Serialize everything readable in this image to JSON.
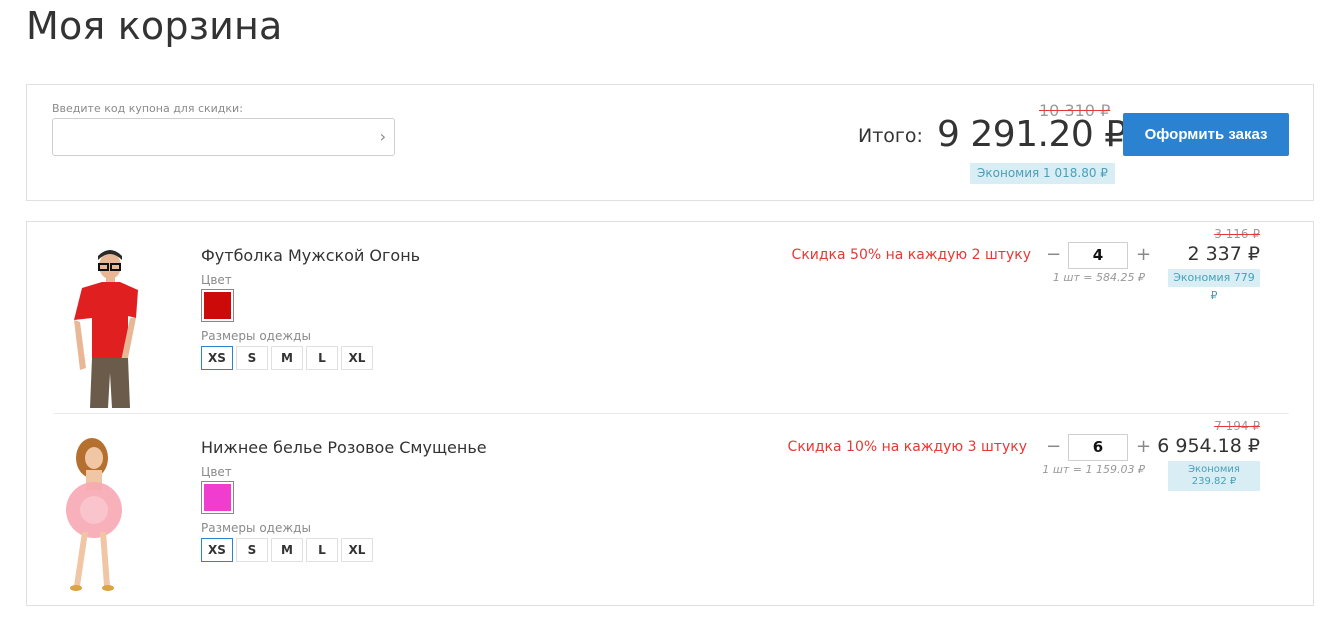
{
  "page": {
    "title": "Моя корзина"
  },
  "coupon": {
    "label": "Введите код купона для скидки:",
    "placeholder": "",
    "submit_icon": "chevron-right-icon"
  },
  "summary": {
    "total_label": "Итого:",
    "old_total": "10 310 ₽",
    "total": "9 291.20 ₽",
    "saving": "Экономия 1 018.80 ₽",
    "checkout_label": "Оформить заказ"
  },
  "items": [
    {
      "name": "Футболка Мужской Огонь",
      "color_label": "Цвет",
      "color": "#cc0a0a",
      "sizes_label": "Размеры одежды",
      "sizes": [
        "XS",
        "S",
        "M",
        "L",
        "XL"
      ],
      "selected_size": "XS",
      "promo": "Скидка 50% на каждую 2 штуку",
      "quantity": "4",
      "unit_price": "1 шт = 584.25 ₽",
      "old_price": "3 116 ₽",
      "price": "2 337 ₽",
      "saving": "Экономия 779 ₽"
    },
    {
      "name": "Нижнее белье Розовое Смущенье",
      "color_label": "Цвет",
      "color": "#f03ccf",
      "sizes_label": "Размеры одежды",
      "sizes": [
        "XS",
        "S",
        "M",
        "L",
        "XL"
      ],
      "selected_size": "XS",
      "promo": "Скидка 10% на каждую 3 штуку",
      "quantity": "6",
      "unit_price": "1 шт = 1 159.03 ₽",
      "old_price": "7 194 ₽",
      "price": "6 954.18 ₽",
      "saving_line1": "Экономия",
      "saving_line2": "239.82 ₽"
    }
  ],
  "colors": {
    "accent": "#2b82d1",
    "discount": "#e53935",
    "saving_bg": "#d8eef4",
    "saving_text": "#4a9fb8"
  }
}
